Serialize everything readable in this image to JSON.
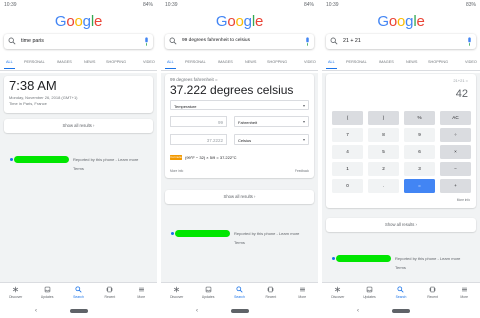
{
  "colors": {
    "accent": "#1a73e8",
    "censor_green": "#00e600",
    "calc_equals": "#4285f4",
    "formula_badge": "#f29900"
  },
  "screens": [
    {
      "status": {
        "time": "10:39",
        "battery": "84%"
      },
      "query": "time paris",
      "tabs": [
        "ALL",
        "PERSONAL",
        "IMAGES",
        "NEWS",
        "SHOPPING",
        "VIDEO"
      ],
      "result": {
        "time": "7:38 AM",
        "date": "Monday, November 26, 2018 (GMT+1)",
        "place": "Time in Paris, France"
      },
      "show_all": "Show all results",
      "report": {
        "text": "Reported by this phone - Learn more",
        "terms": "Terms"
      }
    },
    {
      "status": {
        "time": "10:39",
        "battery": "84%"
      },
      "query": "99 degrees fahrenheit to celsius",
      "tabs": [
        "ALL",
        "PERSONAL",
        "IMAGES",
        "NEWS",
        "SHOPPING",
        "VIDEO"
      ],
      "converter": {
        "question": "99 degrees fahrenheit =",
        "result": "37.222 degrees celsius",
        "unit_type": "Temperature",
        "from_value": "99",
        "from_unit": "Fahrenheit",
        "to_value": "37.2222",
        "to_unit": "Celsius",
        "formula_label": "Formula",
        "formula": "(99°F − 32) × 5/9 = 37.222°C",
        "more_info": "More info",
        "feedback": "Feedback"
      },
      "show_all": "Show all results",
      "report": {
        "text": "Reported by this phone - Learn more",
        "terms": "Terms"
      }
    },
    {
      "status": {
        "time": "10:39",
        "battery": "83%"
      },
      "query": "21 + 21",
      "tabs": [
        "ALL",
        "PERSONAL",
        "IMAGES",
        "NEWS",
        "SHOPPING",
        "VIDEO"
      ],
      "calculator": {
        "expression": "21+21 =",
        "display": "42",
        "keys": [
          "(",
          ")",
          "%",
          "AC",
          "7",
          "8",
          "9",
          "÷",
          "4",
          "5",
          "6",
          "×",
          "1",
          "2",
          "3",
          "−",
          "0",
          ".",
          "=",
          "+"
        ],
        "more_info": "More info"
      },
      "show_all": "Show all results",
      "report": {
        "text": "Reported by this phone - Learn more",
        "terms": "Terms"
      }
    }
  ],
  "bottom_nav": [
    "Discover",
    "Updates",
    "Search",
    "Recent",
    "More"
  ],
  "logo": [
    "G",
    "o",
    "o",
    "g",
    "l",
    "e"
  ]
}
